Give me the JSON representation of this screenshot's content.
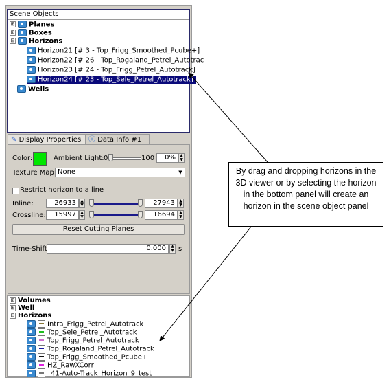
{
  "scene": {
    "title": "Scene Objects",
    "items": [
      {
        "label": "Planes",
        "bold": true,
        "exp": "⊞"
      },
      {
        "label": "Boxes",
        "bold": true,
        "exp": "⊞"
      },
      {
        "label": "Horizons",
        "bold": true,
        "exp": "⊟"
      },
      {
        "label": "Horizon21 [# 3 - Top_Frigg_Smoothed_Pcube+]"
      },
      {
        "label": "Horizon22 [# 26 - Top_Rogaland_Petrel_Autotrac"
      },
      {
        "label": "Horizon23 [# 24 - Top_Frigg_Petrel_Autotrack]"
      },
      {
        "label": "Horizon24 [# 23 - Top_Sele_Petrel_Autotrack]",
        "selected": true
      },
      {
        "label": "Wells",
        "bold": true
      }
    ]
  },
  "tabs": {
    "display": "Display Properties",
    "data": "Data Info #1"
  },
  "props": {
    "color_label": "Color:",
    "color_value": "#00e600",
    "ambient_label": "Ambient Light:",
    "ambient_min": "0",
    "ambient_max": "100",
    "ambient_value": "0%",
    "texture_label": "Texture Map:",
    "texture_value": "None",
    "restrict_label": "Restrict horizon to a line",
    "inline_label": "Inline:",
    "inline_from": "26933",
    "inline_to": "27943",
    "crossline_label": "Crossline:",
    "crossline_from": "15997",
    "crossline_to": "16694",
    "reset_button": "Reset Cutting Planes",
    "timeshift_label": "Time-Shift",
    "timeshift_value": "0.000",
    "timeshift_unit": "s"
  },
  "bottom": {
    "items": [
      {
        "label": "Volumes",
        "exp": "⊞"
      },
      {
        "label": "Well",
        "exp": "⊞"
      },
      {
        "label": "Horizons",
        "exp": "⊟"
      }
    ],
    "horizons": [
      {
        "label": "Intra_Frigg_Petrel_Autotrack",
        "color": "#8a7a3a"
      },
      {
        "label": "Top_Sele_Petrel_Autotrack",
        "color": "#1fbf1f"
      },
      {
        "label": "Top_Frigg_Petrel_Autotrack",
        "color": "#d070d0"
      },
      {
        "label": "Top_Rogaland_Petrel_Autotrack",
        "color": "#1a1aa0"
      },
      {
        "label": "Top_Frigg_Smoothed_Pcube+",
        "color": "#111111"
      },
      {
        "label": "HZ_RawXCorr",
        "color": "#e020e0"
      },
      {
        "label": "_41-Auto-Track_Horizon_9_test",
        "color": "#777777"
      }
    ]
  },
  "callout": {
    "text": "By drag and dropping horizons in the 3D viewer or by selecting the horizon in the bottom panel will create an horizon in the scene object panel"
  }
}
